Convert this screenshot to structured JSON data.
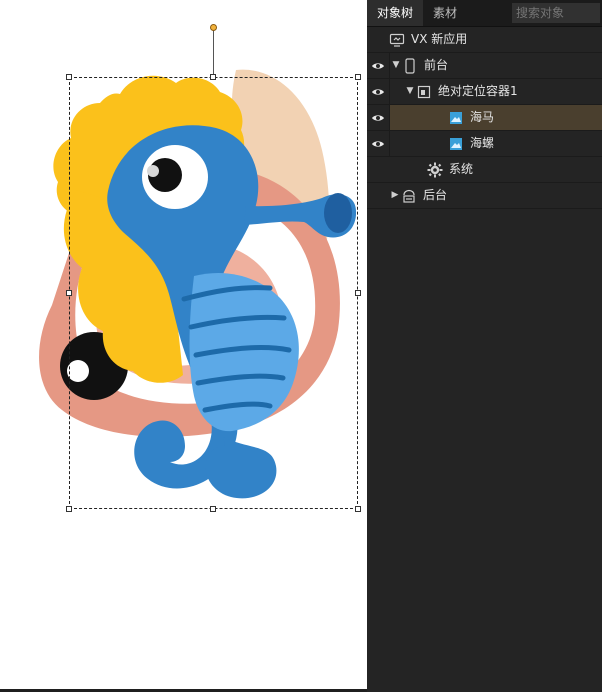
{
  "panel": {
    "tabs": [
      "对象树",
      "素材"
    ],
    "search_placeholder": "搜索对象",
    "tree": {
      "app": "VX 新应用",
      "frontend": "前台",
      "container": "绝对定位容器1",
      "seahorse": "海马",
      "snail": "海螺",
      "system": "系统",
      "backend": "后台"
    }
  },
  "colors": {
    "panel_bg": "#242424",
    "selected_row": "#4a3f2e",
    "icon_blue": "#3aa0d8"
  }
}
